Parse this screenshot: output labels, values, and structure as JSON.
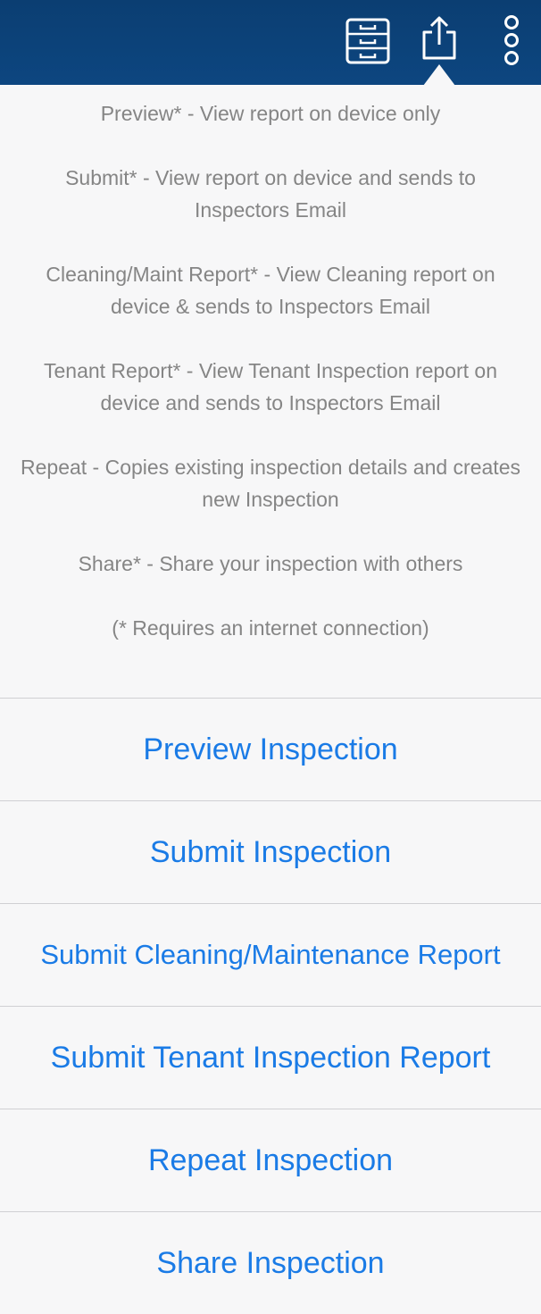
{
  "navbar": {
    "icons": [
      "filing-cabinet-icon",
      "share-icon",
      "more-icon"
    ],
    "background_color": "#0d4680"
  },
  "popover": {
    "descriptions": [
      "Preview* - View report on device only",
      "Submit* - View report on device and sends to Inspectors Email",
      "Cleaning/Maint Report* - View Cleaning report on device & sends to Inspectors Email",
      "Tenant Report* - View Tenant Inspection report on device and sends to Inspectors Email",
      "Repeat - Copies existing inspection details and creates new Inspection",
      "Share* - Share your inspection with others",
      "(* Requires an internet connection)"
    ],
    "actions": [
      "Preview Inspection",
      "Submit Inspection",
      "Submit Cleaning/Maintenance Report",
      "Submit Tenant Inspection Report",
      "Repeat Inspection",
      "Share Inspection"
    ],
    "action_color": "#1a7be6",
    "text_color": "#858585"
  }
}
